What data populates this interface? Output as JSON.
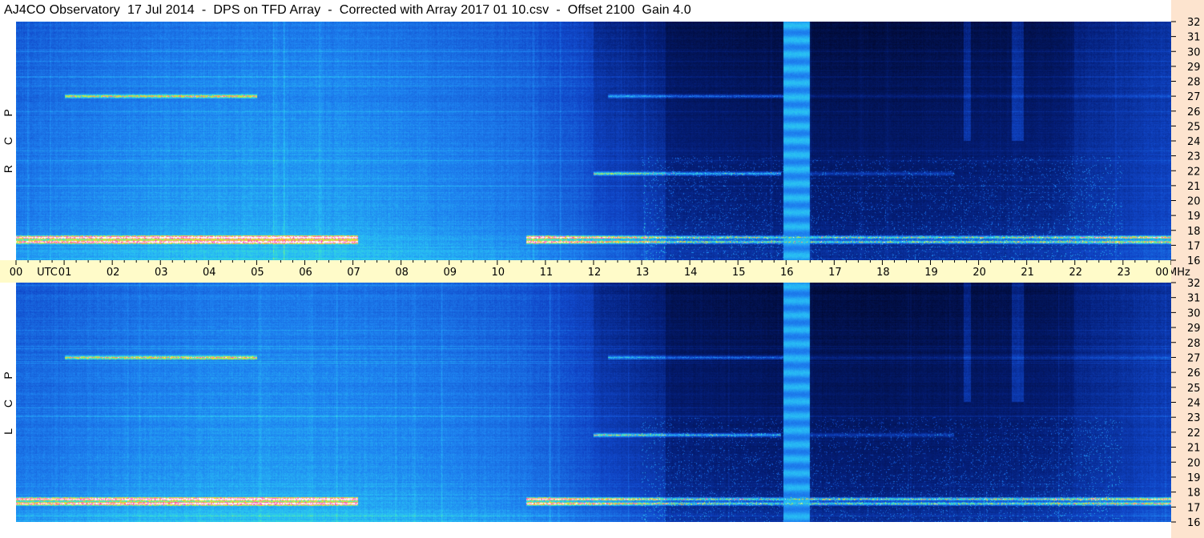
{
  "title": "AJ4CO Observatory  17 Jul 2014  -  DPS on TFD Array  -  Corrected with Array 2017 01 10.csv  -  Offset 2100  Gain 4.0",
  "panels": [
    {
      "id": "rcp",
      "letters": [
        "P",
        "C",
        "R"
      ]
    },
    {
      "id": "lcp",
      "letters": [
        "P",
        "C",
        "L"
      ]
    }
  ],
  "colors": {
    "axis_bg": "#fffbc9",
    "freq_axis_bg": "#fde4cf",
    "low_intensity": "#000a3c",
    "mid_intensity": "#1e7ef0",
    "high_intensity": "#ffffff"
  },
  "chart_data": {
    "type": "heatmap",
    "x_axis": {
      "label": "UTC",
      "ticks": [
        "00",
        "01",
        "02",
        "03",
        "04",
        "05",
        "06",
        "07",
        "08",
        "09",
        "10",
        "11",
        "12",
        "13",
        "14",
        "15",
        "16",
        "17",
        "18",
        "19",
        "20",
        "21",
        "22",
        "23",
        "00"
      ],
      "range": [
        0,
        24
      ]
    },
    "y_axis": {
      "label": "MHz",
      "ticks": [
        "32",
        "31",
        "30",
        "29",
        "28",
        "27",
        "26",
        "25",
        "24",
        "23",
        "22",
        "21",
        "20",
        "19",
        "18",
        "17",
        "16"
      ],
      "range": [
        16,
        32
      ]
    },
    "series": [
      {
        "name": "RCP"
      },
      {
        "name": "LCP"
      }
    ],
    "features": {
      "strong_bands_mhz": [
        27.0,
        21.8,
        17.5,
        17.2
      ],
      "bright_vertical_band_utc": [
        15.95,
        16.5
      ],
      "daytime_bright_region_utc": [
        0,
        10.5
      ],
      "dark_region_utc": [
        13.5,
        21.5
      ]
    }
  }
}
